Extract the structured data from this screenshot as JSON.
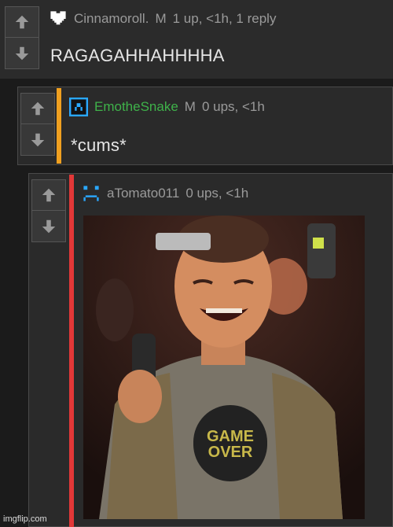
{
  "comments": [
    {
      "username": "Cinnamoroll.",
      "badge": "M",
      "stats": "1 up, <1h, 1 reply",
      "text": "RAGAGAHHAHHHHA",
      "avatar": "heart-pixel-icon"
    },
    {
      "username": "EmotheSnake",
      "badge": "M",
      "stats": "0 ups, <1h",
      "text": "*cums*",
      "avatar": "pixel-face-icon",
      "accent": "#f0a020",
      "name_color": "#3fb24a"
    },
    {
      "username": "aTomato011",
      "stats": "0 ups, <1h",
      "avatar": "sad-pixel-face-icon",
      "accent": "#e23838",
      "meme_text": "GAME\nOVER"
    }
  ],
  "watermark": "imgflip.com"
}
